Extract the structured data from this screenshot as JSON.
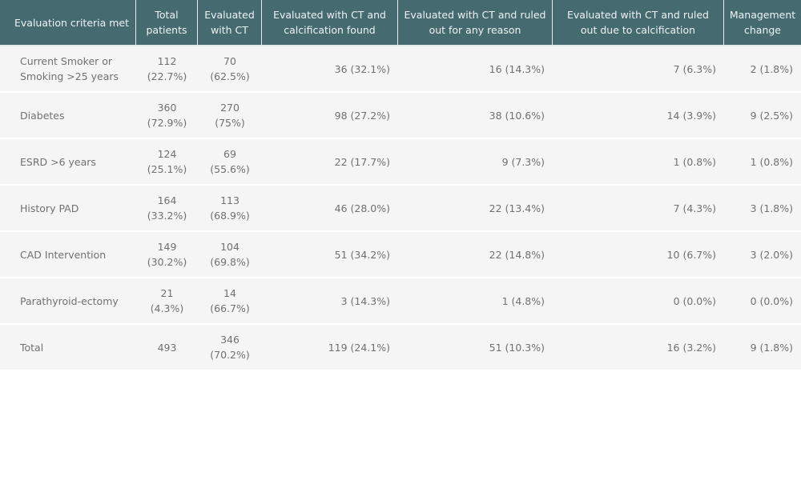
{
  "table": {
    "headers": [
      "Evaluation criteria met",
      "Total patients",
      "Evaluated with CT",
      "Evaluated with CT and calcification found",
      "Evaluated with CT and ruled out for any reason",
      "Evaluated with CT and ruled out due to calcification",
      "Management change"
    ],
    "rows": [
      [
        "Current Smoker or Smoking >25 years",
        "112 (22.7%)",
        "70 (62.5%)",
        "36 (32.1%)",
        "16 (14.3%)",
        "7 (6.3%)",
        "2 (1.8%)"
      ],
      [
        "Diabetes",
        "360 (72.9%)",
        "270 (75%)",
        "98 (27.2%)",
        "38 (10.6%)",
        "14 (3.9%)",
        "9 (2.5%)"
      ],
      [
        "ESRD >6 years",
        "124 (25.1%)",
        "69 (55.6%)",
        "22 (17.7%)",
        "9 (7.3%)",
        "1 (0.8%)",
        "1 (0.8%)"
      ],
      [
        "History PAD",
        "164 (33.2%)",
        "113 (68.9%)",
        "46 (28.0%)",
        "22 (13.4%)",
        "7 (4.3%)",
        "3 (1.8%)"
      ],
      [
        "CAD Intervention",
        "149 (30.2%)",
        "104 (69.8%)",
        "51 (34.2%)",
        "22 (14.8%)",
        "10 (6.7%)",
        "3 (2.0%)"
      ],
      [
        "Parathyroid-ectomy",
        "21 (4.3%)",
        "14 (66.7%)",
        "3 (14.3%)",
        "1 (4.8%)",
        "0 (0.0%)",
        "0 (0.0%)"
      ],
      [
        "Total",
        "493",
        "346 (70.2%)",
        "119 (24.1%)",
        "51 (10.3%)",
        "16 (3.2%)",
        "9 (1.8%)"
      ]
    ]
  },
  "colors": {
    "header_bg": "#456b71",
    "header_text": "#eef3f3",
    "row_bg": "#f5f5f5",
    "cell_text": "#707070"
  }
}
